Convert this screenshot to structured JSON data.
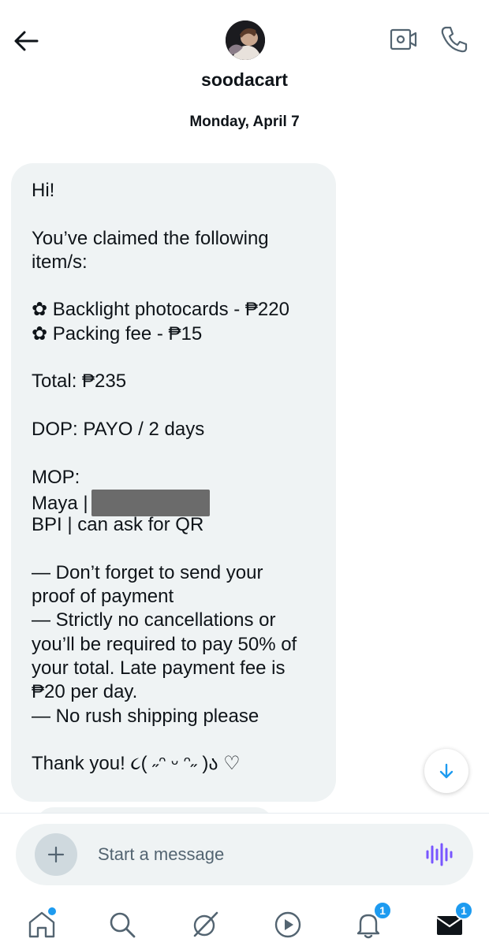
{
  "header": {
    "username": "soodacart"
  },
  "conversation": {
    "date": "Monday, April 7",
    "message_lines": [
      "Hi!",
      "",
      "You’ve claimed the following",
      "item/s:",
      "",
      "✿ Backlight photocards - ₱220",
      "✿ Packing fee - ₱15",
      "",
      "Total: ₱235",
      "",
      "DOP: PAYO / 2 days",
      "",
      "MOP:",
      "Maya |",
      "BPI | can ask for QR",
      "",
      "— Don’t forget to send your",
      "proof of payment",
      "— Strictly no cancellations or",
      "you’ll be required to pay 50% of",
      "your total. Late payment fee is",
      "₱20 per day.",
      "— No rush shipping please",
      "",
      "Thank you! ૮( ˶ᵔ ᵕ ᵔ˶ )ა ♡"
    ]
  },
  "composer": {
    "placeholder": "Start a message"
  },
  "tabs": {
    "notifications_badge": "1",
    "messages_badge": "1"
  },
  "colors": {
    "accent": "#1d9bf0",
    "bubble_bg": "#eff3f4",
    "voice_icon": "#7856ff",
    "icon_gray": "#536471"
  }
}
